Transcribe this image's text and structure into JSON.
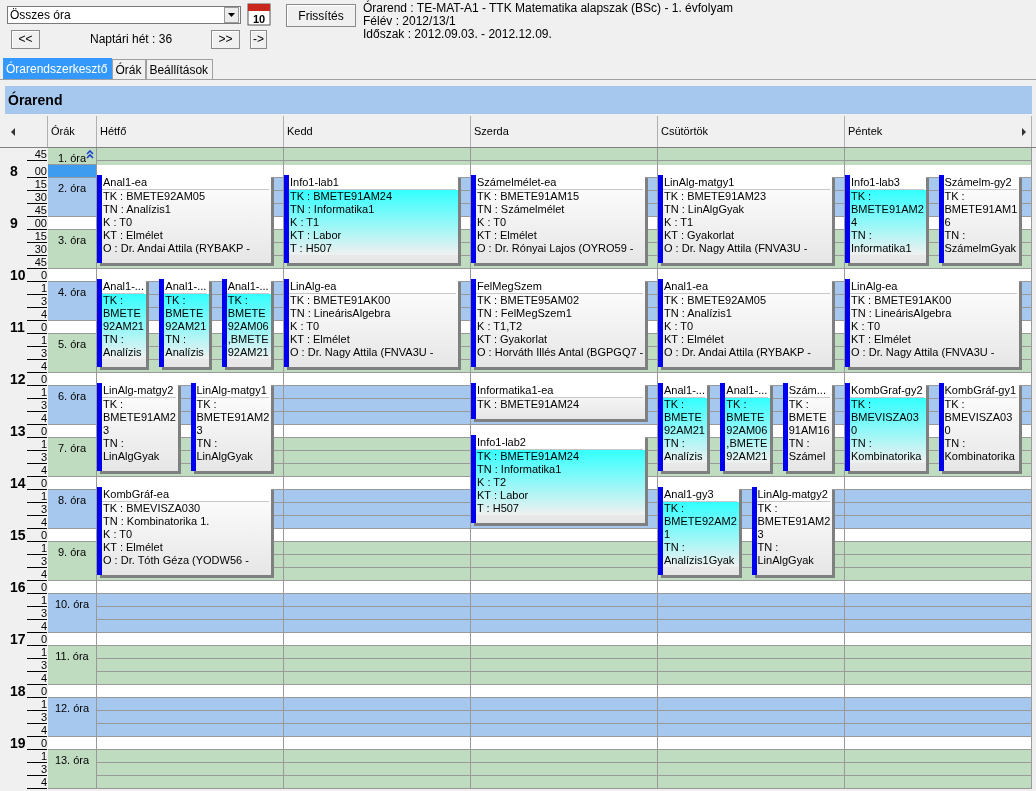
{
  "toolbar": {
    "filter": {
      "value": "Összes óra"
    },
    "calendar_day": "10",
    "refresh_button": "Frissítés",
    "prev_button": "<<",
    "week_label": "Naptári hét : 36",
    "next_button": ">>",
    "go_button": "->"
  },
  "info_lines": [
    "Órarend : TE-MAT-A1 - TTK Matematika alapszak (BSc) - 1. évfolyam",
    "Félév : 2012/13/1",
    "Időszak : 2012.09.03. - 2012.12.09."
  ],
  "tabs": [
    {
      "label": "Órarendszerkesztő",
      "selected": true
    },
    {
      "label": "Órák",
      "selected": false
    },
    {
      "label": "Beállítások",
      "selected": false
    }
  ],
  "panel_title": "Órarend",
  "periods_header": "Órák",
  "periods": [
    {
      "label": "1. óra",
      "minutes": [
        "45"
      ],
      "collapse_toggle": true
    },
    {
      "label": "2. óra",
      "hour": "8",
      "minutes": [
        "00",
        "15",
        "30",
        "45"
      ],
      "gap_selected": true,
      "collapse_toggle": false
    },
    {
      "label": "3. óra",
      "hour": "9",
      "minutes": [
        "00",
        "15",
        "30",
        "45"
      ],
      "gap_selected": false,
      "collapse_toggle": false
    },
    {
      "label": "4. óra",
      "hour": "10",
      "minutes": [
        "0",
        "1",
        "3",
        "4"
      ],
      "gap_selected": false,
      "collapse_toggle": false
    },
    {
      "label": "5. óra",
      "hour": "11",
      "minutes": [
        "0",
        "1",
        "3",
        "4"
      ],
      "gap_selected": false,
      "collapse_toggle": false
    },
    {
      "label": "6. óra",
      "hour": "12",
      "minutes": [
        "0",
        "1",
        "3",
        "4"
      ],
      "gap_selected": false,
      "collapse_toggle": false
    },
    {
      "label": "7. óra",
      "hour": "13",
      "minutes": [
        "0",
        "1",
        "3",
        "4"
      ],
      "gap_selected": false,
      "collapse_toggle": false
    },
    {
      "label": "8. óra",
      "hour": "14",
      "minutes": [
        "0",
        "1",
        "3",
        "4"
      ],
      "gap_selected": false,
      "collapse_toggle": false
    },
    {
      "label": "9. óra",
      "hour": "15",
      "minutes": [
        "0",
        "1",
        "3",
        "4"
      ],
      "gap_selected": false,
      "collapse_toggle": false
    },
    {
      "label": "10. óra",
      "hour": "16",
      "minutes": [
        "0",
        "1",
        "3",
        "4"
      ],
      "gap_selected": false,
      "collapse_toggle": false
    },
    {
      "label": "11. óra",
      "hour": "17",
      "minutes": [
        "0",
        "1",
        "3",
        "4"
      ],
      "gap_selected": false,
      "collapse_toggle": false
    },
    {
      "label": "12. óra",
      "hour": "18",
      "minutes": [
        "0",
        "1",
        "3",
        "4"
      ],
      "gap_selected": false,
      "collapse_toggle": false
    },
    {
      "label": "13. óra",
      "hour": "19",
      "minutes": [
        "0",
        "1",
        "3",
        "4"
      ],
      "gap_selected": false,
      "collapse_toggle": false
    }
  ],
  "days": [
    {
      "name": "Hétfő",
      "blocks": [
        {
          "kind": "double",
          "events": [
            {
              "title": "Anal1-ea",
              "highlight": false,
              "lines": [
                "TK : BMETE92AM05",
                "TN : Analízis1",
                "K : T0",
                "KT : Elmélet",
                "O :  Dr. Andai Attila (RYBAKP -"
              ]
            }
          ]
        },
        {
          "kind": "double",
          "events": [
            {
              "title": "Anal1-...",
              "highlight": true,
              "lines": [
                "TK :",
                "BMETE",
                "92AM21",
                "TN :",
                "Analízis"
              ]
            },
            {
              "title": "Anal1-...",
              "highlight": true,
              "lines": [
                "TK :",
                "BMETE",
                "92AM21",
                "TN :",
                "Analízis"
              ]
            },
            {
              "title": "Anal1-...",
              "highlight": true,
              "lines": [
                "TK :",
                "BMETE",
                "92AM06",
                ",BMETE",
                "92AM21"
              ]
            }
          ]
        },
        {
          "kind": "double",
          "events": [
            {
              "title": "LinAlg-matgy2",
              "highlight": false,
              "lines": [
                "TK :",
                "BMETE91AM2",
                "3",
                "TN :",
                "LinAlgGyak"
              ]
            },
            {
              "title": "LinAlg-matgy1",
              "highlight": false,
              "lines": [
                "TK :",
                "BMETE91AM2",
                "3",
                "TN :",
                "LinAlgGyak"
              ]
            }
          ]
        },
        {
          "kind": "double",
          "events": [
            {
              "title": "KombGráf-ea",
              "highlight": false,
              "lines": [
                "TK : BMEVISZA030",
                "TN : Kombinatorika 1.",
                "K : T0",
                "KT : Elmélet",
                "O :  Dr. Tóth Géza (YODW56 -"
              ]
            }
          ]
        }
      ]
    },
    {
      "name": "Kedd",
      "blocks": [
        {
          "kind": "double",
          "events": [
            {
              "title": "Info1-lab1",
              "highlight": true,
              "lines": [
                "TK : BMETE91AM24",
                "TN : Informatika1",
                "K : T1",
                "KT : Labor",
                "T : H507"
              ]
            }
          ]
        },
        {
          "kind": "double",
          "events": [
            {
              "title": "LinAlg-ea",
              "highlight": false,
              "lines": [
                "TK : BMETE91AK00",
                "TN : LineárisAlgebra",
                "K : T0",
                "KT : Elmélet",
                "O :  Dr. Nagy Attila (FNVA3U -"
              ]
            }
          ]
        }
      ]
    },
    {
      "name": "Szerda",
      "blocks": [
        {
          "kind": "double",
          "events": [
            {
              "title": "Számelmélet-ea",
              "highlight": false,
              "lines": [
                "TK : BMETE91AM15",
                "TN : Számelmélet",
                "K : T0",
                "KT : Elmélet",
                "O :  Dr. Rónyai Lajos (OYRO59 -"
              ]
            }
          ]
        },
        {
          "kind": "double",
          "events": [
            {
              "title": "FelMegSzem",
              "highlight": false,
              "lines": [
                "TK : BMETE95AM02",
                "TN : FelMegSzem1",
                "K : T1,T2",
                "KT : Gyakorlat",
                "O :  Horváth Illés Antal (BGPGQ7 -"
              ]
            }
          ]
        },
        {
          "kind": "single",
          "events": [
            {
              "title": "Informatika1-ea",
              "highlight": false,
              "lines": [
                "TK : BMETE91AM24"
              ]
            }
          ]
        },
        {
          "kind": "double",
          "events": [
            {
              "title": "Info1-lab2",
              "highlight": true,
              "lines": [
                "TK : BMETE91AM24",
                "TN : Informatika1",
                "K : T2",
                "KT : Labor",
                "T : H507"
              ]
            }
          ]
        }
      ]
    },
    {
      "name": "Csütörtök",
      "blocks": [
        {
          "kind": "double",
          "events": [
            {
              "title": "LinAlg-matgy1",
              "highlight": false,
              "lines": [
                "TK : BMETE91AM23",
                "TN : LinAlgGyak",
                "K : T1",
                "KT : Gyakorlat",
                "O :  Dr. Nagy Attila (FNVA3U -"
              ]
            }
          ]
        },
        {
          "kind": "double",
          "events": [
            {
              "title": "Anal1-ea",
              "highlight": false,
              "lines": [
                "TK : BMETE92AM05",
                "TN : Analízis1",
                "K : T0",
                "KT : Elmélet",
                "O :  Dr. Andai Attila (RYBAKP -"
              ]
            }
          ]
        },
        {
          "kind": "double",
          "events": [
            {
              "title": "Anal1-...",
              "highlight": true,
              "lines": [
                "TK :",
                "BMETE",
                "92AM21",
                "TN :",
                "Analízis"
              ]
            },
            {
              "title": "Anal1-...",
              "highlight": true,
              "lines": [
                "TK :",
                "BMETE",
                "92AM06",
                ",BMETE",
                "92AM21"
              ]
            },
            {
              "title": "Szám...",
              "highlight": false,
              "lines": [
                "TK :",
                "BMETE",
                "91AM16",
                "TN :",
                "Számel"
              ]
            }
          ]
        },
        {
          "kind": "double",
          "events": [
            {
              "title": "Anal1-gy3",
              "highlight": true,
              "lines": [
                "TK :",
                "BMETE92AM2",
                "1",
                "TN :",
                "Analízis1Gyak"
              ]
            },
            {
              "title": "LinAlg-matgy2",
              "highlight": false,
              "lines": [
                "TK :",
                "BMETE91AM2",
                "3",
                "TN :",
                "LinAlgGyak"
              ]
            }
          ]
        }
      ]
    },
    {
      "name": "Péntek",
      "blocks": [
        {
          "kind": "double",
          "events": [
            {
              "title": "Info1-lab3",
              "highlight": true,
              "lines": [
                "TK :",
                "BMETE91AM2",
                "4",
                "TN :",
                "Informatika1"
              ]
            },
            {
              "title": "Számelm-gy2",
              "highlight": false,
              "lines": [
                "TK :",
                "BMETE91AM1",
                "6",
                "TN :",
                "SzámelmGyak"
              ]
            }
          ]
        },
        {
          "kind": "double",
          "events": [
            {
              "title": "LinAlg-ea",
              "highlight": false,
              "lines": [
                "TK : BMETE91AK00",
                "TN : LineárisAlgebra",
                "K : T0",
                "KT : Elmélet",
                "O :  Dr. Nagy Attila (FNVA3U -"
              ]
            }
          ]
        },
        {
          "kind": "double",
          "events": [
            {
              "title": "KombGraf-gy2",
              "highlight": true,
              "lines": [
                "TK :",
                "BMEVISZA03",
                "0",
                "TN :",
                "Kombinatorika"
              ]
            },
            {
              "title": "KombGráf-gy1",
              "highlight": false,
              "lines": [
                "TK :",
                "BMEVISZA03",
                "0",
                "TN :",
                "Kombinatorika"
              ]
            }
          ]
        }
      ]
    }
  ]
}
